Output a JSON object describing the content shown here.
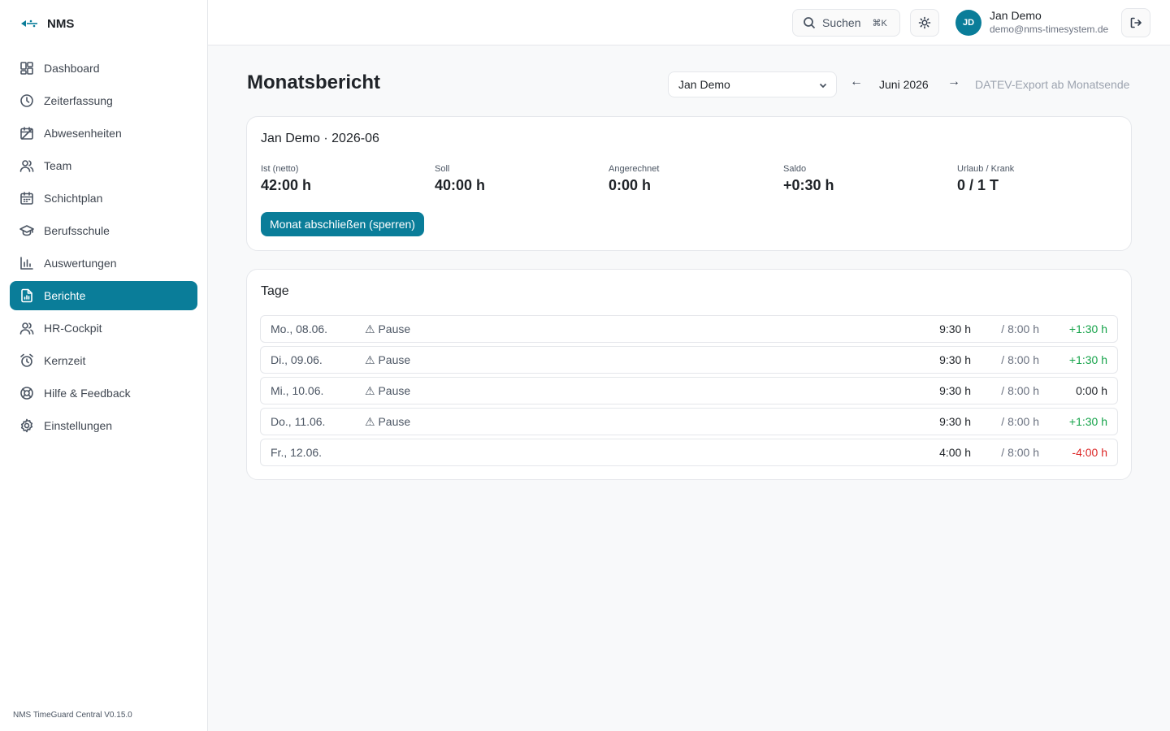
{
  "app": {
    "name": "NMS",
    "version": "NMS TimeGuard Central V0.15.0"
  },
  "sidebar": {
    "items": [
      {
        "label": "Dashboard",
        "icon": "dashboard-icon",
        "active": false
      },
      {
        "label": "Zeiterfassung",
        "icon": "clock-icon",
        "active": false
      },
      {
        "label": "Abwesenheiten",
        "icon": "calendar-off-icon",
        "active": false
      },
      {
        "label": "Team",
        "icon": "users-icon",
        "active": false
      },
      {
        "label": "Schichtplan",
        "icon": "calendar-icon",
        "active": false
      },
      {
        "label": "Berufsschule",
        "icon": "graduation-cap-icon",
        "active": false
      },
      {
        "label": "Auswertungen",
        "icon": "bar-chart-icon",
        "active": false
      },
      {
        "label": "Berichte",
        "icon": "report-file-icon",
        "active": true
      },
      {
        "label": "HR-Cockpit",
        "icon": "users-icon",
        "active": false
      },
      {
        "label": "Kernzeit",
        "icon": "alarm-clock-icon",
        "active": false
      },
      {
        "label": "Hilfe & Feedback",
        "icon": "lifebuoy-icon",
        "active": false
      },
      {
        "label": "Einstellungen",
        "icon": "gear-icon",
        "active": false
      }
    ]
  },
  "topbar": {
    "search_label": "Suchen",
    "search_shortcut": "⌘K",
    "user_initials": "JD",
    "user_name": "Jan Demo",
    "user_email": "demo@nms-timesystem.de"
  },
  "page": {
    "title": "Monatsbericht",
    "employee_selected": "Jan Demo",
    "month_label": "Juni 2026",
    "prev_arrow": "←",
    "next_arrow": "→",
    "datev_note": "DATEV-Export ab Monatsende"
  },
  "summary": {
    "title": "Jan Demo · 2026-06",
    "stats": [
      {
        "label": "Ist (netto)",
        "value": "42:00 h"
      },
      {
        "label": "Soll",
        "value": "40:00 h"
      },
      {
        "label": "Angerechnet",
        "value": "0:00 h"
      },
      {
        "label": "Saldo",
        "value": "+0:30 h"
      },
      {
        "label": "Urlaub / Krank",
        "value": "0 / 1 T"
      }
    ],
    "lock_button": "Monat abschließen (sperren)"
  },
  "days": {
    "title": "Tage",
    "rows": [
      {
        "date": "Mo., 08.06.",
        "warning": "⚠ Pause",
        "ist": "9:30 h",
        "soll": "/ 8:00 h",
        "saldo": "+1:30 h",
        "saldo_color": "#16a34a"
      },
      {
        "date": "Di., 09.06.",
        "warning": "⚠ Pause",
        "ist": "9:30 h",
        "soll": "/ 8:00 h",
        "saldo": "+1:30 h",
        "saldo_color": "#16a34a"
      },
      {
        "date": "Mi., 10.06.",
        "warning": "⚠ Pause",
        "ist": "9:30 h",
        "soll": "/ 8:00 h",
        "saldo": "0:00 h",
        "saldo_color": "#1f2328"
      },
      {
        "date": "Do., 11.06.",
        "warning": "⚠ Pause",
        "ist": "9:30 h",
        "soll": "/ 8:00 h",
        "saldo": "+1:30 h",
        "saldo_color": "#16a34a"
      },
      {
        "date": "Fr., 12.06.",
        "warning": "",
        "ist": "4:00 h",
        "soll": "/ 8:00 h",
        "saldo": "-4:00 h",
        "saldo_color": "#dc2626"
      }
    ]
  },
  "colors": {
    "accent": "#0a7d99",
    "positive": "#16a34a",
    "negative": "#dc2626"
  }
}
